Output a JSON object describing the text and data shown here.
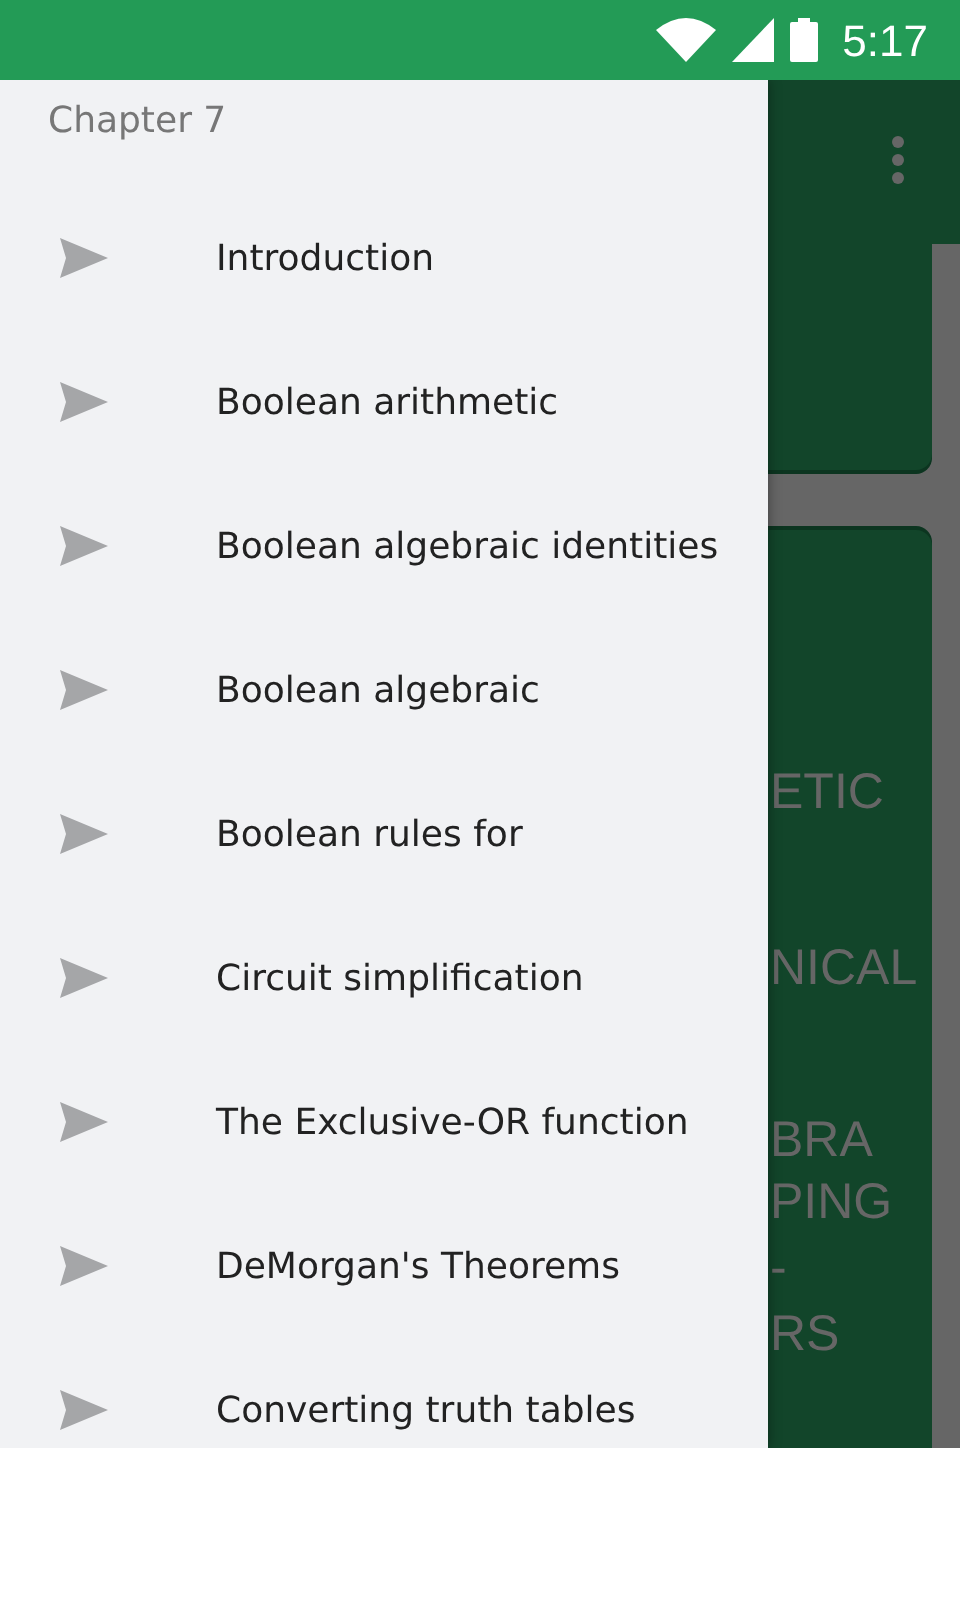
{
  "status_bar": {
    "time": "5:17"
  },
  "drawer": {
    "header": "Chapter 7",
    "items": [
      {
        "label": "Introduction"
      },
      {
        "label": "Boolean arithmetic"
      },
      {
        "label": "Boolean algebraic identities"
      },
      {
        "label": "Boolean algebraic"
      },
      {
        "label": "Boolean rules for"
      },
      {
        "label": "Circuit simplification"
      },
      {
        "label": "The Exclusive-OR function"
      },
      {
        "label": "DeMorgan's Theorems"
      },
      {
        "label": "Converting truth tables"
      }
    ]
  },
  "background_card": {
    "blocks": [
      [
        "ETIC"
      ],
      [
        "NICAL"
      ],
      [
        "BRA",
        "PING",
        "-",
        "RS"
      ]
    ]
  }
}
